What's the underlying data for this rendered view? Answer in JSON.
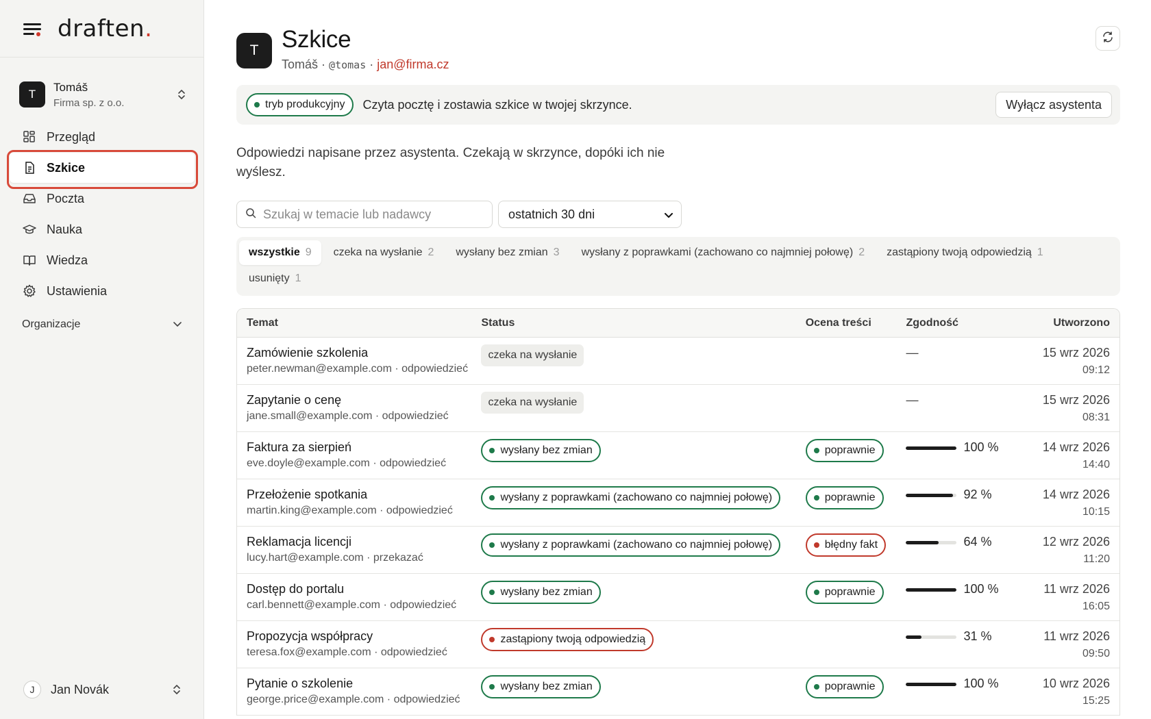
{
  "app": {
    "logo_text": "draften",
    "logo_dot": "."
  },
  "sidebar": {
    "account": {
      "initial": "T",
      "name": "Tomáš",
      "company": "Firma sp. z o.o."
    },
    "items": [
      {
        "label": "Przegląd",
        "icon": "dashboard-icon"
      },
      {
        "label": "Szkice",
        "icon": "document-icon",
        "active": true
      },
      {
        "label": "Poczta",
        "icon": "inbox-icon"
      },
      {
        "label": "Nauka",
        "icon": "graduation-cap-icon"
      },
      {
        "label": "Wiedza",
        "icon": "book-icon"
      },
      {
        "label": "Ustawienia",
        "icon": "gear-icon"
      }
    ],
    "organizations_label": "Organizacje",
    "user": {
      "initial": "J",
      "name": "Jan Novák"
    }
  },
  "header": {
    "initial": "T",
    "title": "Szkice",
    "name": "Tomáš",
    "sep": "·",
    "handle": "@tomas",
    "email": "jan@firma.cz"
  },
  "banner": {
    "mode_label": "tryb produkcyjny",
    "text": "Czyta pocztę i zostawia szkice w twojej skrzynce.",
    "disable_button": "Wyłącz asystenta"
  },
  "description": "Odpowiedzi napisane przez asystenta. Czekają w skrzynce, dopóki ich nie wyślesz.",
  "search": {
    "placeholder": "Szukaj w temacie lub nadawcy"
  },
  "range_select": {
    "value": "ostatnich 30 dni"
  },
  "filters": [
    {
      "label": "wszystkie",
      "count": "9",
      "active": true
    },
    {
      "label": "czeka na wysłanie",
      "count": "2"
    },
    {
      "label": "wysłany bez zmian",
      "count": "3"
    },
    {
      "label": "wysłany z poprawkami (zachowano co najmniej połowę)",
      "count": "2"
    },
    {
      "label": "zastąpiony twoją odpowiedzią",
      "count": "1"
    },
    {
      "label": "usunięty",
      "count": "1"
    }
  ],
  "table": {
    "columns": [
      "Temat",
      "Status",
      "Ocena treści",
      "Zgodność",
      "Utworzono"
    ],
    "rows": [
      {
        "subject": "Zamówienie szkolenia",
        "sender": "peter.newman@example.com",
        "action": "odpowiedzieć",
        "status": "czeka na wysłanie",
        "status_kind": "pending",
        "rating": "",
        "rating_kind": "",
        "match": null,
        "match_label": "—",
        "date": "15 wrz 2026",
        "time": "09:12"
      },
      {
        "subject": "Zapytanie o cenę",
        "sender": "jane.small@example.com",
        "action": "odpowiedzieć",
        "status": "czeka na wysłanie",
        "status_kind": "pending",
        "rating": "",
        "rating_kind": "",
        "match": null,
        "match_label": "—",
        "date": "15 wrz 2026",
        "time": "08:31"
      },
      {
        "subject": "Faktura za sierpień",
        "sender": "eve.doyle@example.com",
        "action": "odpowiedzieć",
        "status": "wysłany bez zmian",
        "status_kind": "green",
        "rating": "poprawnie",
        "rating_kind": "green",
        "match": 100,
        "match_label": "100 %",
        "date": "14 wrz 2026",
        "time": "14:40"
      },
      {
        "subject": "Przełożenie spotkania",
        "sender": "martin.king@example.com",
        "action": "odpowiedzieć",
        "status": "wysłany z poprawkami (zachowano co najmniej połowę)",
        "status_kind": "green",
        "rating": "poprawnie",
        "rating_kind": "green",
        "match": 92,
        "match_label": "92 %",
        "date": "14 wrz 2026",
        "time": "10:15"
      },
      {
        "subject": "Reklamacja licencji",
        "sender": "lucy.hart@example.com",
        "action": "przekazać",
        "status": "wysłany z poprawkami (zachowano co najmniej połowę)",
        "status_kind": "green",
        "rating": "błędny fakt",
        "rating_kind": "red",
        "match": 64,
        "match_label": "64 %",
        "date": "12 wrz 2026",
        "time": "11:20"
      },
      {
        "subject": "Dostęp do portalu",
        "sender": "carl.bennett@example.com",
        "action": "odpowiedzieć",
        "status": "wysłany bez zmian",
        "status_kind": "green",
        "rating": "poprawnie",
        "rating_kind": "green",
        "match": 100,
        "match_label": "100 %",
        "date": "11 wrz 2026",
        "time": "16:05"
      },
      {
        "subject": "Propozycja współpracy",
        "sender": "teresa.fox@example.com",
        "action": "odpowiedzieć",
        "status": "zastąpiony twoją odpowiedzią",
        "status_kind": "red",
        "rating": "",
        "rating_kind": "",
        "match": 31,
        "match_label": "31 %",
        "date": "11 wrz 2026",
        "time": "09:50"
      },
      {
        "subject": "Pytanie o szkolenie",
        "sender": "george.price@example.com",
        "action": "odpowiedzieć",
        "status": "wysłany bez zmian",
        "status_kind": "green",
        "rating": "poprawnie",
        "rating_kind": "green",
        "match": 100,
        "match_label": "100 %",
        "date": "10 wrz 2026",
        "time": "15:25"
      }
    ]
  },
  "colors": {
    "accent_red": "#d0392c",
    "status_green": "#1e7a4a",
    "status_red": "#c0392b"
  }
}
